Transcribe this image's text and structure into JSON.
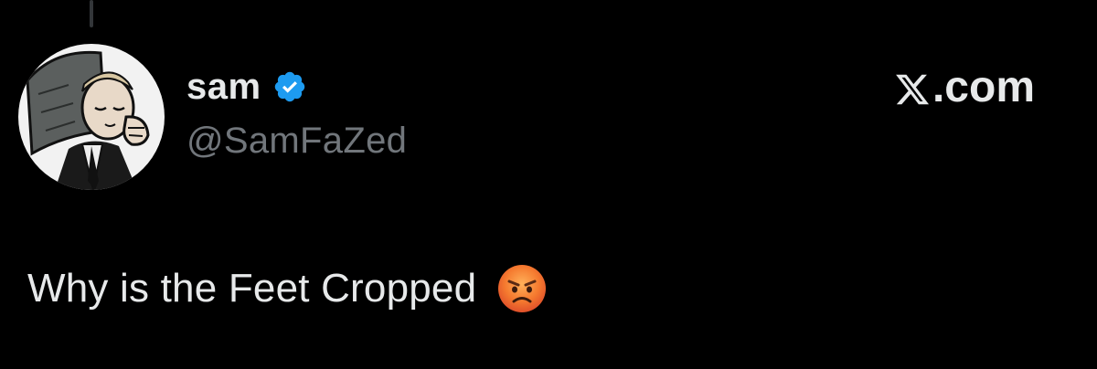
{
  "tweet": {
    "author": {
      "display_name": "sam",
      "handle": "@SamFaZed",
      "avatar_icon": "avatar-comic-sleeping-man",
      "verified_icon": "verified-badge-icon",
      "verified_color": "#1d9bf0"
    },
    "watermark": {
      "logo_icon": "x-logo-icon",
      "text": ".com"
    },
    "body": {
      "text": "Why is the Feet Cropped",
      "emoji_icon": "angry-face-icon"
    }
  },
  "colors": {
    "background": "#000000",
    "primary_text": "#e7e9ea",
    "secondary_text": "#71767b",
    "thread_line": "#333639"
  }
}
